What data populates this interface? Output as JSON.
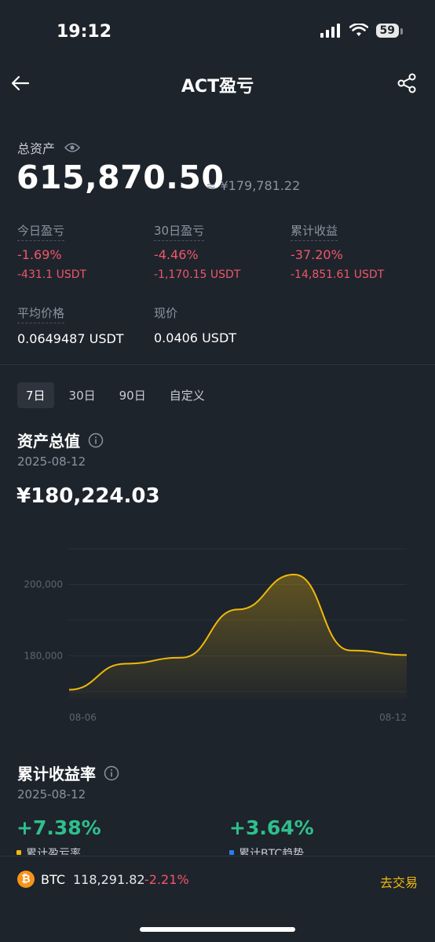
{
  "status_bar": {
    "time": "19:12",
    "battery": "59"
  },
  "nav": {
    "title": "ACT盈亏"
  },
  "summary": {
    "total_label": "总资产",
    "total_value": "615,870.50",
    "total_cny": "≈ ¥179,781.22"
  },
  "stats": {
    "today": {
      "label": "今日盈亏",
      "pct": "-1.69%",
      "usdt": "-431.1 USDT"
    },
    "d30": {
      "label": "30日盈亏",
      "pct": "-4.46%",
      "usdt": "-1,170.15 USDT"
    },
    "cumulative": {
      "label": "累计收益",
      "pct": "-37.20%",
      "usdt": "-14,851.61 USDT"
    },
    "avg_price": {
      "label": "平均价格",
      "value": "0.0649487 USDT"
    },
    "current_price": {
      "label": "现价",
      "value": "0.0406 USDT"
    }
  },
  "tabs": [
    "7日",
    "30日",
    "90日",
    "自定义"
  ],
  "asset_section": {
    "title": "资产总值",
    "date": "2025-08-12",
    "amount": "¥180,224.03"
  },
  "chart_data": {
    "type": "area",
    "x": [
      "08-06",
      "08-07",
      "08-08",
      "08-09",
      "08-10",
      "08-11",
      "08-12"
    ],
    "values": [
      170500,
      177800,
      179500,
      193000,
      202800,
      181500,
      180224
    ],
    "xlabel": "",
    "ylabel": "",
    "x_tick_labels": [
      "08-06",
      "08-12"
    ],
    "y_tick_labels": [
      "200,000",
      "180,000"
    ],
    "y_ticks": [
      200000,
      180000
    ],
    "ylim": [
      168000,
      212000
    ],
    "grid": true,
    "line_color": "#f0b90b"
  },
  "return_section": {
    "title": "累计收益率",
    "date": "2025-08-12",
    "pnl_rate": "+7.38%",
    "pnl_label": "累计盈亏率",
    "btc_rate": "+3.64%",
    "btc_label": "累计BTC趋势",
    "colors": {
      "positive": "#2fbf8d",
      "pnl_dot": "#f0b90b",
      "btc_dot": "#2f7bf0"
    }
  },
  "ticker": {
    "icon": "₿",
    "symbol": "BTC",
    "price": "118,291.82",
    "change": "-2.21%",
    "trade_label": "去交易"
  }
}
